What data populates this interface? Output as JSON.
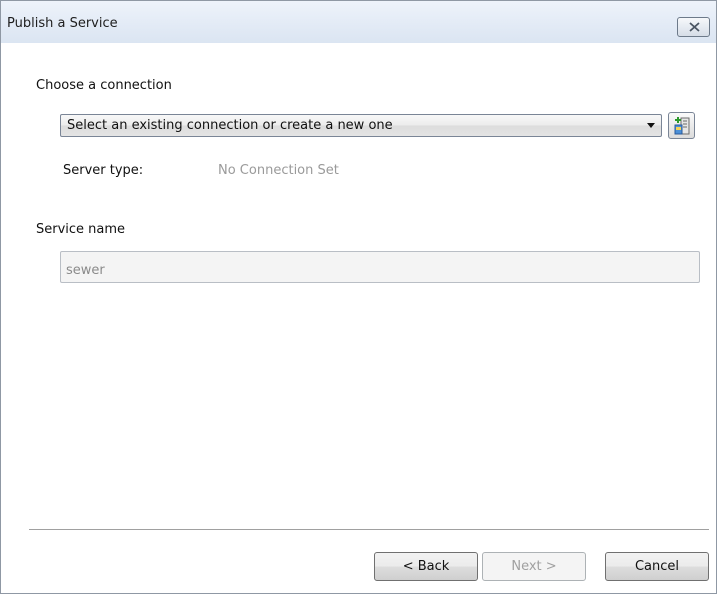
{
  "window": {
    "title": "Publish a Service"
  },
  "connection": {
    "section_label": "Choose a connection",
    "combo_value": "Select an existing connection or create a new one",
    "server_type_label": "Server type:",
    "server_type_value": "No Connection Set"
  },
  "service": {
    "section_label": "Service name",
    "value": "sewer"
  },
  "footer": {
    "back_label": "< Back",
    "next_label": "Next >",
    "cancel_label": "Cancel"
  },
  "icons": {
    "close": "close-icon",
    "dropdown": "chevron-down-icon",
    "add_connection": "add-server-connection-icon"
  },
  "colors": {
    "titlebar": "#e3ebf6",
    "disabled_text": "#9a9a9a"
  }
}
